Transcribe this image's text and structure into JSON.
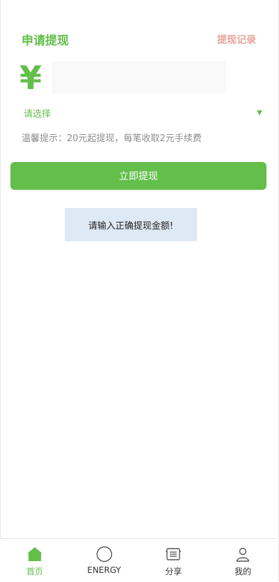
{
  "header": {
    "title": "申请提现",
    "records_link": "提现记录"
  },
  "amount": {
    "currency_symbol": "¥",
    "value": "",
    "placeholder": ""
  },
  "account_select": {
    "selected": "请选择",
    "arrow": "▼"
  },
  "tip": "温馨提示：20元起提现，每笔收取2元手续费",
  "submit_label": "立即提现",
  "toast": "请输入正确提现金额!",
  "tabbar": {
    "active_index": 0,
    "items": [
      {
        "label": "首页",
        "icon": "home-icon"
      },
      {
        "label": "ENERGY",
        "icon": "circle-icon"
      },
      {
        "label": "分享",
        "icon": "share-list-icon"
      },
      {
        "label": "我的",
        "icon": "user-icon"
      }
    ]
  },
  "colors": {
    "accent": "#63be4a",
    "link": "#e3a59c",
    "toast_bg": "#dde9f5"
  }
}
